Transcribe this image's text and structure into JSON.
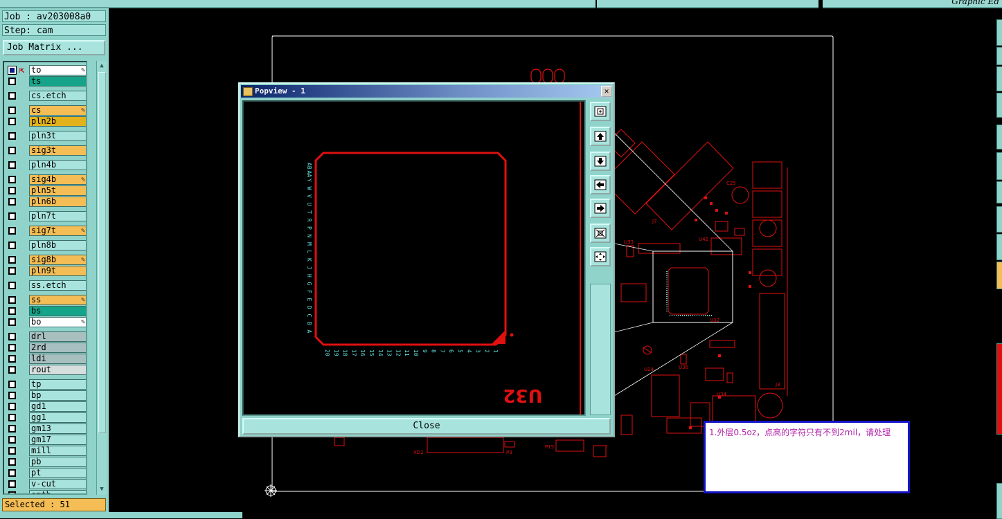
{
  "app": {
    "title_fragment": "Graphic Ed"
  },
  "job": {
    "job_line": "Job : av203008a0",
    "step_line": "Step: cam",
    "matrix_button": "Job Matrix ..."
  },
  "layers": [
    {
      "name": "to",
      "color": "white",
      "checked": true,
      "marker": "⇱",
      "editable": true
    },
    {
      "name": "ts",
      "color": "teal"
    },
    {
      "name": "cs.etch",
      "color": "plain"
    },
    {
      "name": "cs",
      "color": "orange",
      "editable": true
    },
    {
      "name": "pln2b",
      "color": "gold"
    },
    {
      "name": "pln3t",
      "color": "plain"
    },
    {
      "name": "sig3t",
      "color": "orange"
    },
    {
      "name": "pln4b",
      "color": "plain"
    },
    {
      "name": "sig4b",
      "color": "orange",
      "editable": true
    },
    {
      "name": "pln5t",
      "color": "orange"
    },
    {
      "name": "pln6b",
      "color": "orange"
    },
    {
      "name": "pln7t",
      "color": "plain"
    },
    {
      "name": "sig7t",
      "color": "orange",
      "editable": true
    },
    {
      "name": "pln8b",
      "color": "plain"
    },
    {
      "name": "sig8b",
      "color": "orange",
      "editable": true
    },
    {
      "name": "pln9t",
      "color": "orange"
    },
    {
      "name": "ss.etch",
      "color": "plain"
    },
    {
      "name": "ss",
      "color": "orange",
      "editable": true
    },
    {
      "name": "bs",
      "color": "teal"
    },
    {
      "name": "bo",
      "color": "white",
      "editable": true
    },
    {
      "name": "drl",
      "color": "gray"
    },
    {
      "name": "2rd",
      "color": "gray"
    },
    {
      "name": "ldi",
      "color": "gray"
    },
    {
      "name": "rout",
      "color": "lgray"
    },
    {
      "name": "tp",
      "color": "plain"
    },
    {
      "name": "bp",
      "color": "plain"
    },
    {
      "name": "gd1",
      "color": "plain"
    },
    {
      "name": "gg1",
      "color": "plain"
    },
    {
      "name": "gm13",
      "color": "plain"
    },
    {
      "name": "gm17",
      "color": "plain"
    },
    {
      "name": "mill",
      "color": "plain"
    },
    {
      "name": "pb",
      "color": "plain"
    },
    {
      "name": "pt",
      "color": "plain"
    },
    {
      "name": "v-cut",
      "color": "plain"
    },
    {
      "name": "smth",
      "color": "plain"
    }
  ],
  "status": {
    "selected": "Selected : 51"
  },
  "popview": {
    "title": "Popview - 1",
    "close_label": "Close",
    "component_label": "U32",
    "left_pin_labels": [
      "AB",
      "AA",
      "Y",
      "W",
      "V",
      "U",
      "T",
      "R",
      "P",
      "N",
      "M",
      "L",
      "K",
      "J",
      "H",
      "G",
      "F",
      "E",
      "D",
      "C",
      "B",
      "A"
    ],
    "bottom_pin_labels": [
      "20",
      "19",
      "18",
      "17",
      "16",
      "15",
      "14",
      "13",
      "12",
      "11",
      "10",
      "9",
      "8",
      "7",
      "6",
      "5",
      "4",
      "3",
      "2",
      "1"
    ],
    "tools": [
      "zoom-fit-icon",
      "pan-up-icon",
      "pan-down-icon",
      "pan-left-icon",
      "pan-right-icon",
      "zoom-out-icon",
      "zoom-in-icon"
    ]
  },
  "board_labels": {
    "xd2": "XD2",
    "p3": "P3",
    "p15": "P15",
    "u33": "U33",
    "u34": "U34",
    "u36": "U36",
    "u24": "U24",
    "u42": "U42",
    "c25": "C25",
    "u32_small": "U32",
    "j7": "J7",
    "j3": "J3"
  },
  "note": {
    "text": "1.外层0.5oz，点高的字符只有不到2mil，请处理"
  },
  "colors": {
    "trace": "#e01010",
    "panel": "#8fd3cb",
    "accent_orange": "#f4bd55",
    "note_border": "#1414c8",
    "note_text": "#b01ea8"
  }
}
